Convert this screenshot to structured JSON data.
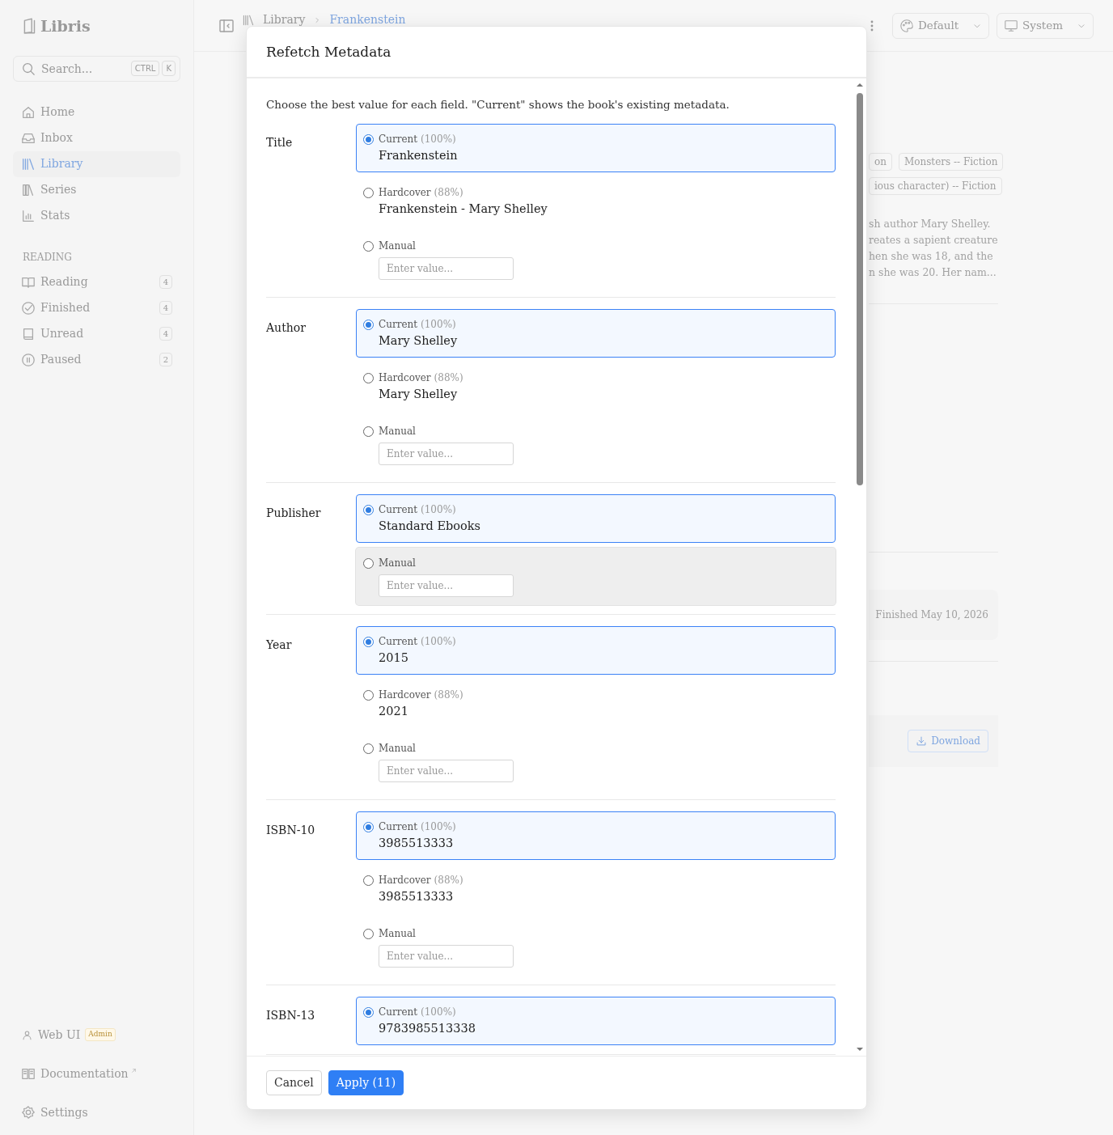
{
  "sidebar": {
    "logo": "Libris",
    "search": {
      "placeholder": "Search...",
      "keys": [
        "CTRL",
        "K"
      ]
    },
    "nav": [
      {
        "label": "Home",
        "selected": false
      },
      {
        "label": "Inbox",
        "selected": false
      },
      {
        "label": "Library",
        "selected": true
      },
      {
        "label": "Series",
        "selected": false
      },
      {
        "label": "Stats",
        "selected": false
      }
    ],
    "section_title": "READING",
    "reading": [
      {
        "label": "Reading",
        "count": "4"
      },
      {
        "label": "Finished",
        "count": "4"
      },
      {
        "label": "Unread",
        "count": "4"
      },
      {
        "label": "Paused",
        "count": "2"
      }
    ],
    "footer": [
      {
        "label": "Web UI",
        "badge": "Admin"
      },
      {
        "label": "Documentation",
        "external": true
      },
      {
        "label": "Settings"
      }
    ]
  },
  "topbar": {
    "breadcrumb": [
      "Library",
      "Frankenstein"
    ],
    "theme": "Default",
    "mode": "System"
  },
  "book": {
    "tags": [
      "on",
      "Monsters -- Fiction",
      "ious character) -- Fiction"
    ],
    "description": [
      "sh author Mary Shelley.",
      "reates a sapient creature",
      "hen she was 18, and the",
      "n she was 20. Her nam..."
    ],
    "finished": "Finished May 10, 2026",
    "download": "Download"
  },
  "modal": {
    "title": "Refetch Metadata",
    "intro": "Choose the best value for each field. \"Current\" shows the book's existing metadata.",
    "fields": [
      {
        "label": "Title",
        "options": [
          {
            "kind": "source",
            "source": "Current",
            "confidence": "(100%)",
            "value": "Frankenstein",
            "selected": true,
            "hovered": false
          },
          {
            "kind": "source",
            "source": "Hardcover",
            "confidence": "(88%)",
            "value": "Frankenstein - Mary Shelley",
            "selected": false,
            "hovered": false
          },
          {
            "kind": "manual",
            "source": "Manual",
            "placeholder": "Enter value...",
            "selected": false,
            "hovered": false
          }
        ]
      },
      {
        "label": "Author",
        "options": [
          {
            "kind": "source",
            "source": "Current",
            "confidence": "(100%)",
            "value": "Mary Shelley",
            "selected": true,
            "hovered": false
          },
          {
            "kind": "source",
            "source": "Hardcover",
            "confidence": "(88%)",
            "value": "Mary Shelley",
            "selected": false,
            "hovered": false
          },
          {
            "kind": "manual",
            "source": "Manual",
            "placeholder": "Enter value...",
            "selected": false,
            "hovered": false
          }
        ]
      },
      {
        "label": "Publisher",
        "options": [
          {
            "kind": "source",
            "source": "Current",
            "confidence": "(100%)",
            "value": "Standard Ebooks",
            "selected": true,
            "hovered": false
          },
          {
            "kind": "manual",
            "source": "Manual",
            "placeholder": "Enter value...",
            "selected": false,
            "hovered": true
          }
        ]
      },
      {
        "label": "Year",
        "options": [
          {
            "kind": "source",
            "source": "Current",
            "confidence": "(100%)",
            "value": "2015",
            "selected": true,
            "hovered": false
          },
          {
            "kind": "source",
            "source": "Hardcover",
            "confidence": "(88%)",
            "value": "2021",
            "selected": false,
            "hovered": false
          },
          {
            "kind": "manual",
            "source": "Manual",
            "placeholder": "Enter value...",
            "selected": false,
            "hovered": false
          }
        ]
      },
      {
        "label": "ISBN-10",
        "options": [
          {
            "kind": "source",
            "source": "Current",
            "confidence": "(100%)",
            "value": "3985513333",
            "selected": true,
            "hovered": false
          },
          {
            "kind": "source",
            "source": "Hardcover",
            "confidence": "(88%)",
            "value": "3985513333",
            "selected": false,
            "hovered": false
          },
          {
            "kind": "manual",
            "source": "Manual",
            "placeholder": "Enter value...",
            "selected": false,
            "hovered": false
          }
        ]
      },
      {
        "label": "ISBN-13",
        "options": [
          {
            "kind": "source",
            "source": "Current",
            "confidence": "(100%)",
            "value": "9783985513338",
            "selected": true,
            "hovered": false
          }
        ]
      }
    ],
    "buttons": [
      {
        "label": "Cancel",
        "kind": "secondary"
      },
      {
        "label": "Apply (11)",
        "kind": "primary"
      }
    ]
  }
}
